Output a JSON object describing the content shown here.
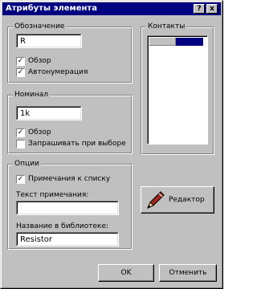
{
  "window": {
    "title": "Атрибуты элемента",
    "help_label": "?",
    "close_label": "x"
  },
  "designation": {
    "legend": "Обозначение",
    "value": "R",
    "view_label": "Обзор",
    "view_checked": true,
    "autonum_label": "Автонумерация",
    "autonum_checked": true
  },
  "nominal": {
    "legend": "Номинал",
    "value": "1k",
    "view_label": "Обзор",
    "view_checked": true,
    "request_label": "Запрашивать при выборе",
    "request_checked": false
  },
  "options": {
    "legend": "Опции",
    "note_to_list_label": "Примечания к списку",
    "note_to_list_checked": true,
    "note_text_label": "Текст примечания:",
    "note_text_value": "",
    "library_name_label": "Название в библиотеке:",
    "library_name_value": "Resistor"
  },
  "contacts": {
    "legend": "Контакты"
  },
  "buttons": {
    "edit_label": "Редактор",
    "ok_label": "OK",
    "cancel_label": "Отменить"
  }
}
